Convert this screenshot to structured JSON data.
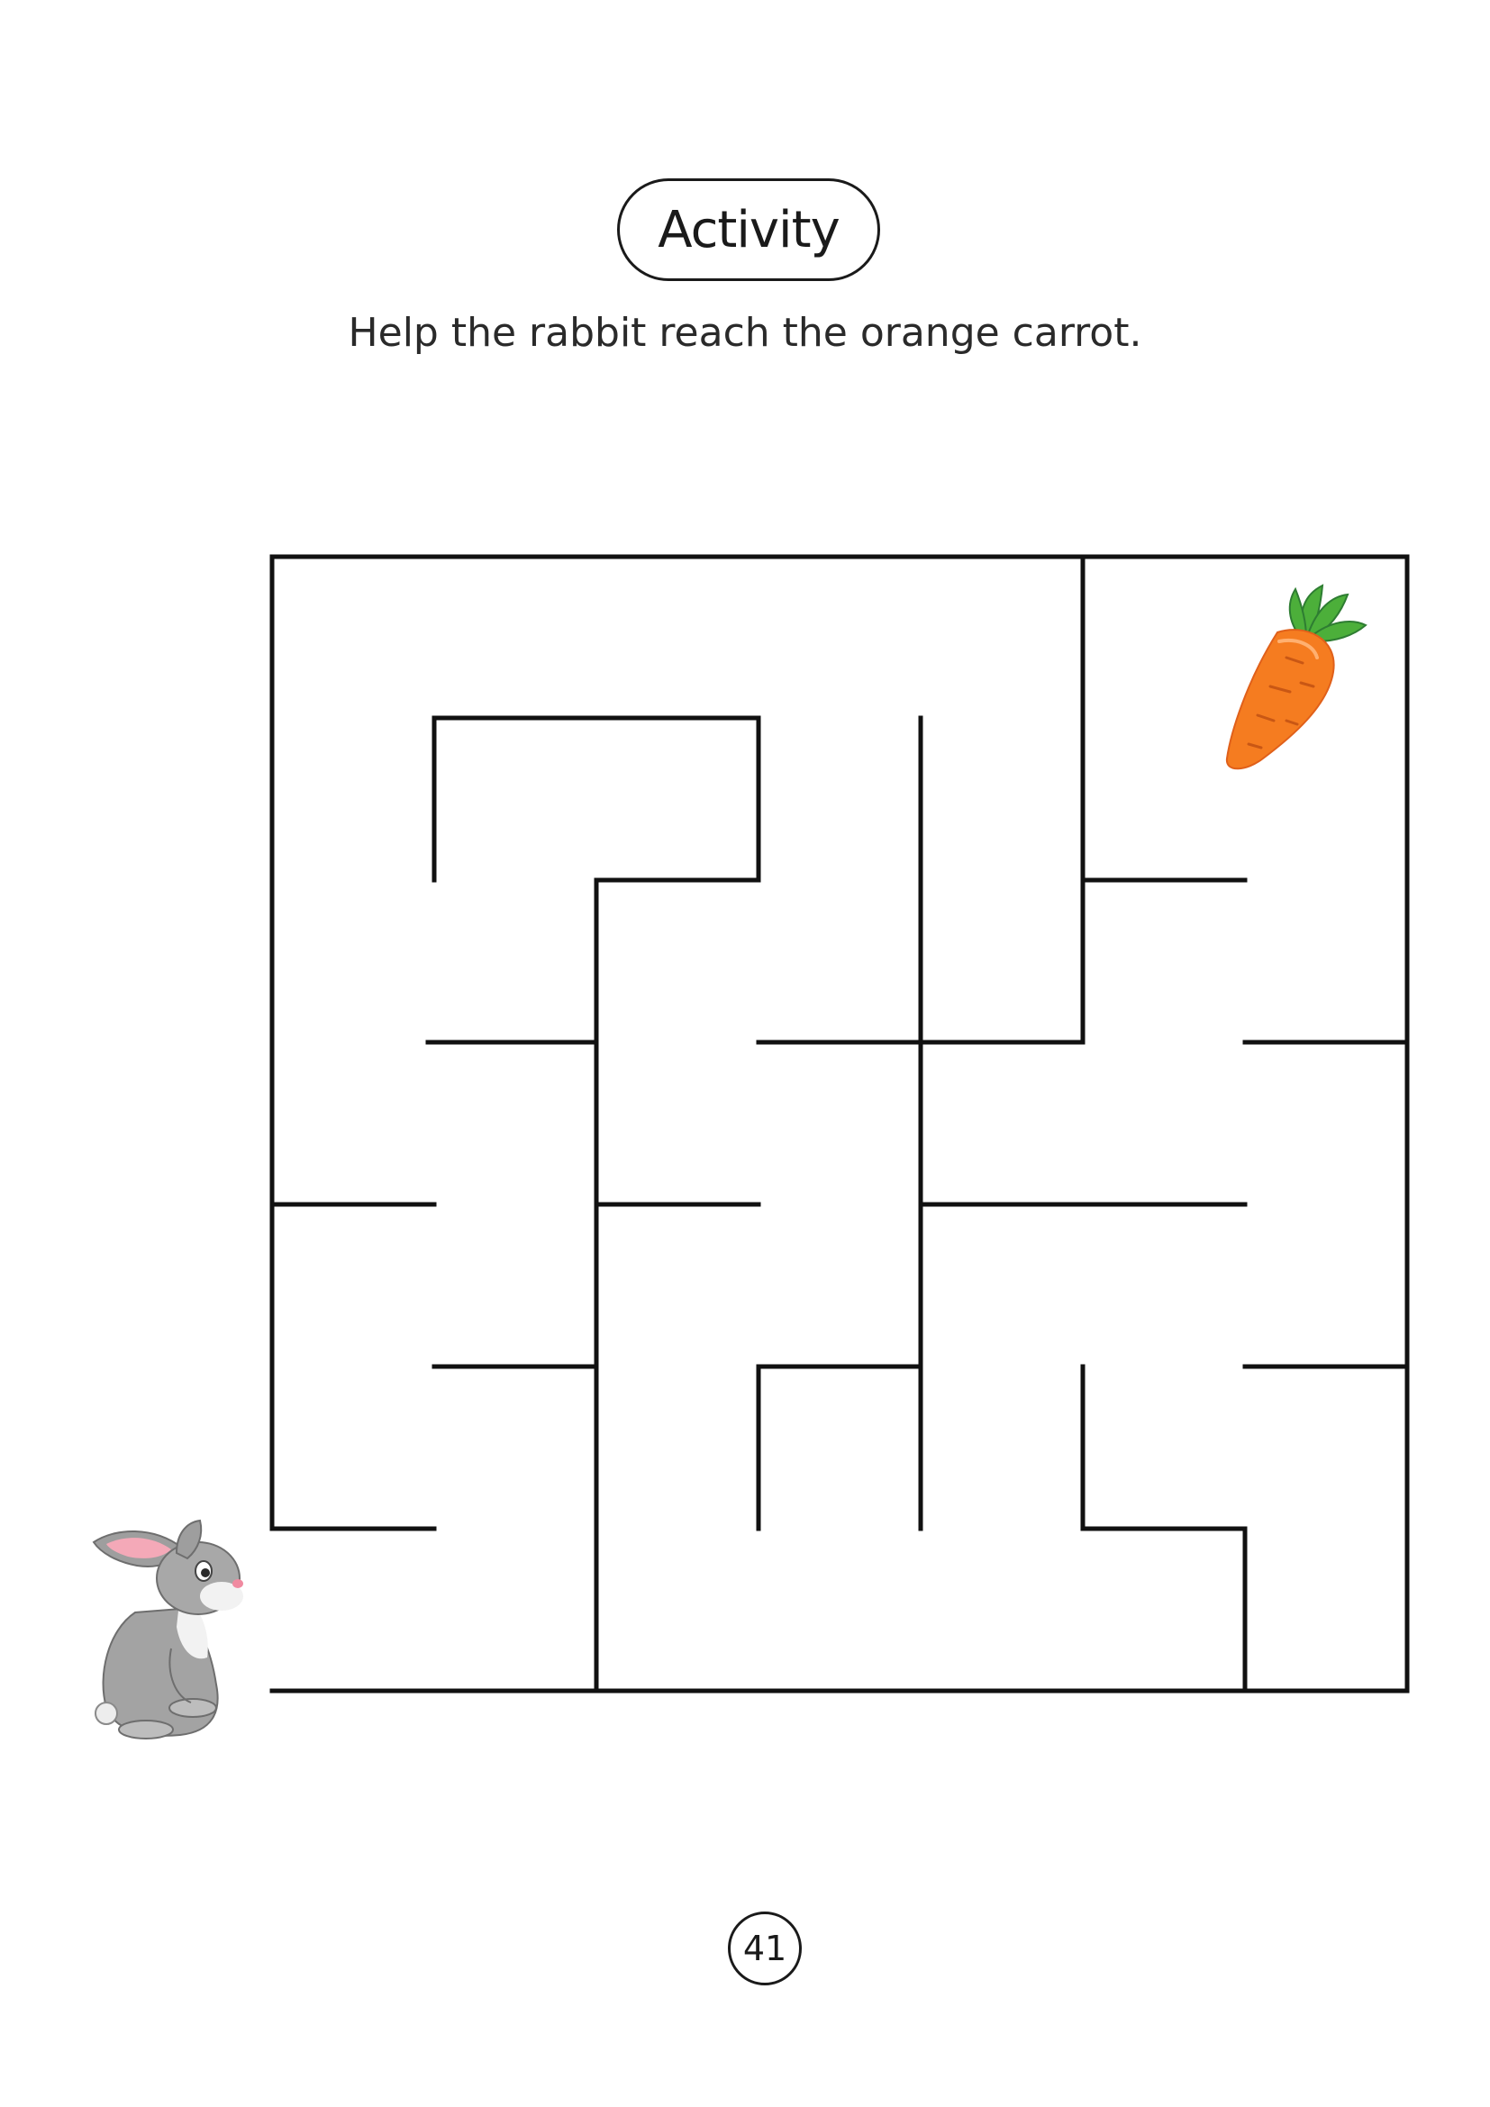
{
  "header": {
    "title": "Activity",
    "instruction": "Help the rabbit reach the orange carrot."
  },
  "maze": {
    "start_character": "rabbit",
    "goal_character": "carrot",
    "colors": {
      "wall": "#111111",
      "carrot_body": "#F57C20",
      "carrot_leaves": "#4CAF3A",
      "rabbit_fur": "#9E9E9E",
      "rabbit_ear_inner": "#F4A9B8"
    }
  },
  "footer": {
    "page_number": "41"
  }
}
